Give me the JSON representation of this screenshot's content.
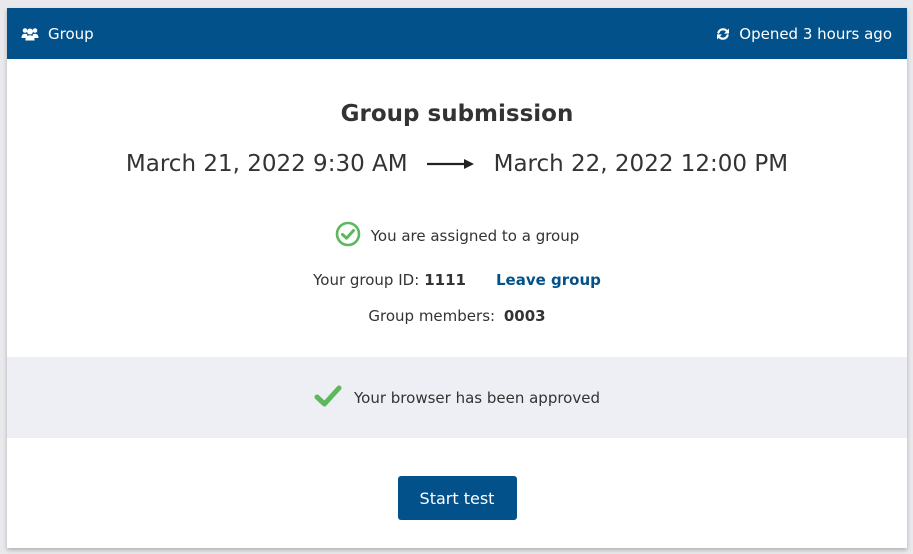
{
  "header": {
    "left_label": "Group",
    "left_icon": "users-icon",
    "right_label": "Opened 3 hours ago",
    "right_icon": "refresh-icon"
  },
  "title": "Group submission",
  "dates": {
    "start": "March 21, 2022 9:30 AM",
    "end": "March 22, 2022 12:00 PM",
    "separator_icon": "arrow-right-icon"
  },
  "assignment": {
    "status_text": "You are assigned to a group",
    "status_icon": "check-circle-icon",
    "group_id_label": "Your group ID:",
    "group_id_value": "1111",
    "leave_label": "Leave group",
    "members_label": "Group members:",
    "members_value": "0003"
  },
  "browser": {
    "status_text": "Your browser has been approved",
    "status_icon": "check-icon"
  },
  "actions": {
    "start_label": "Start test"
  },
  "colors": {
    "primary": "#02518a",
    "success": "#5cb85c",
    "band": "#eeeff4"
  }
}
